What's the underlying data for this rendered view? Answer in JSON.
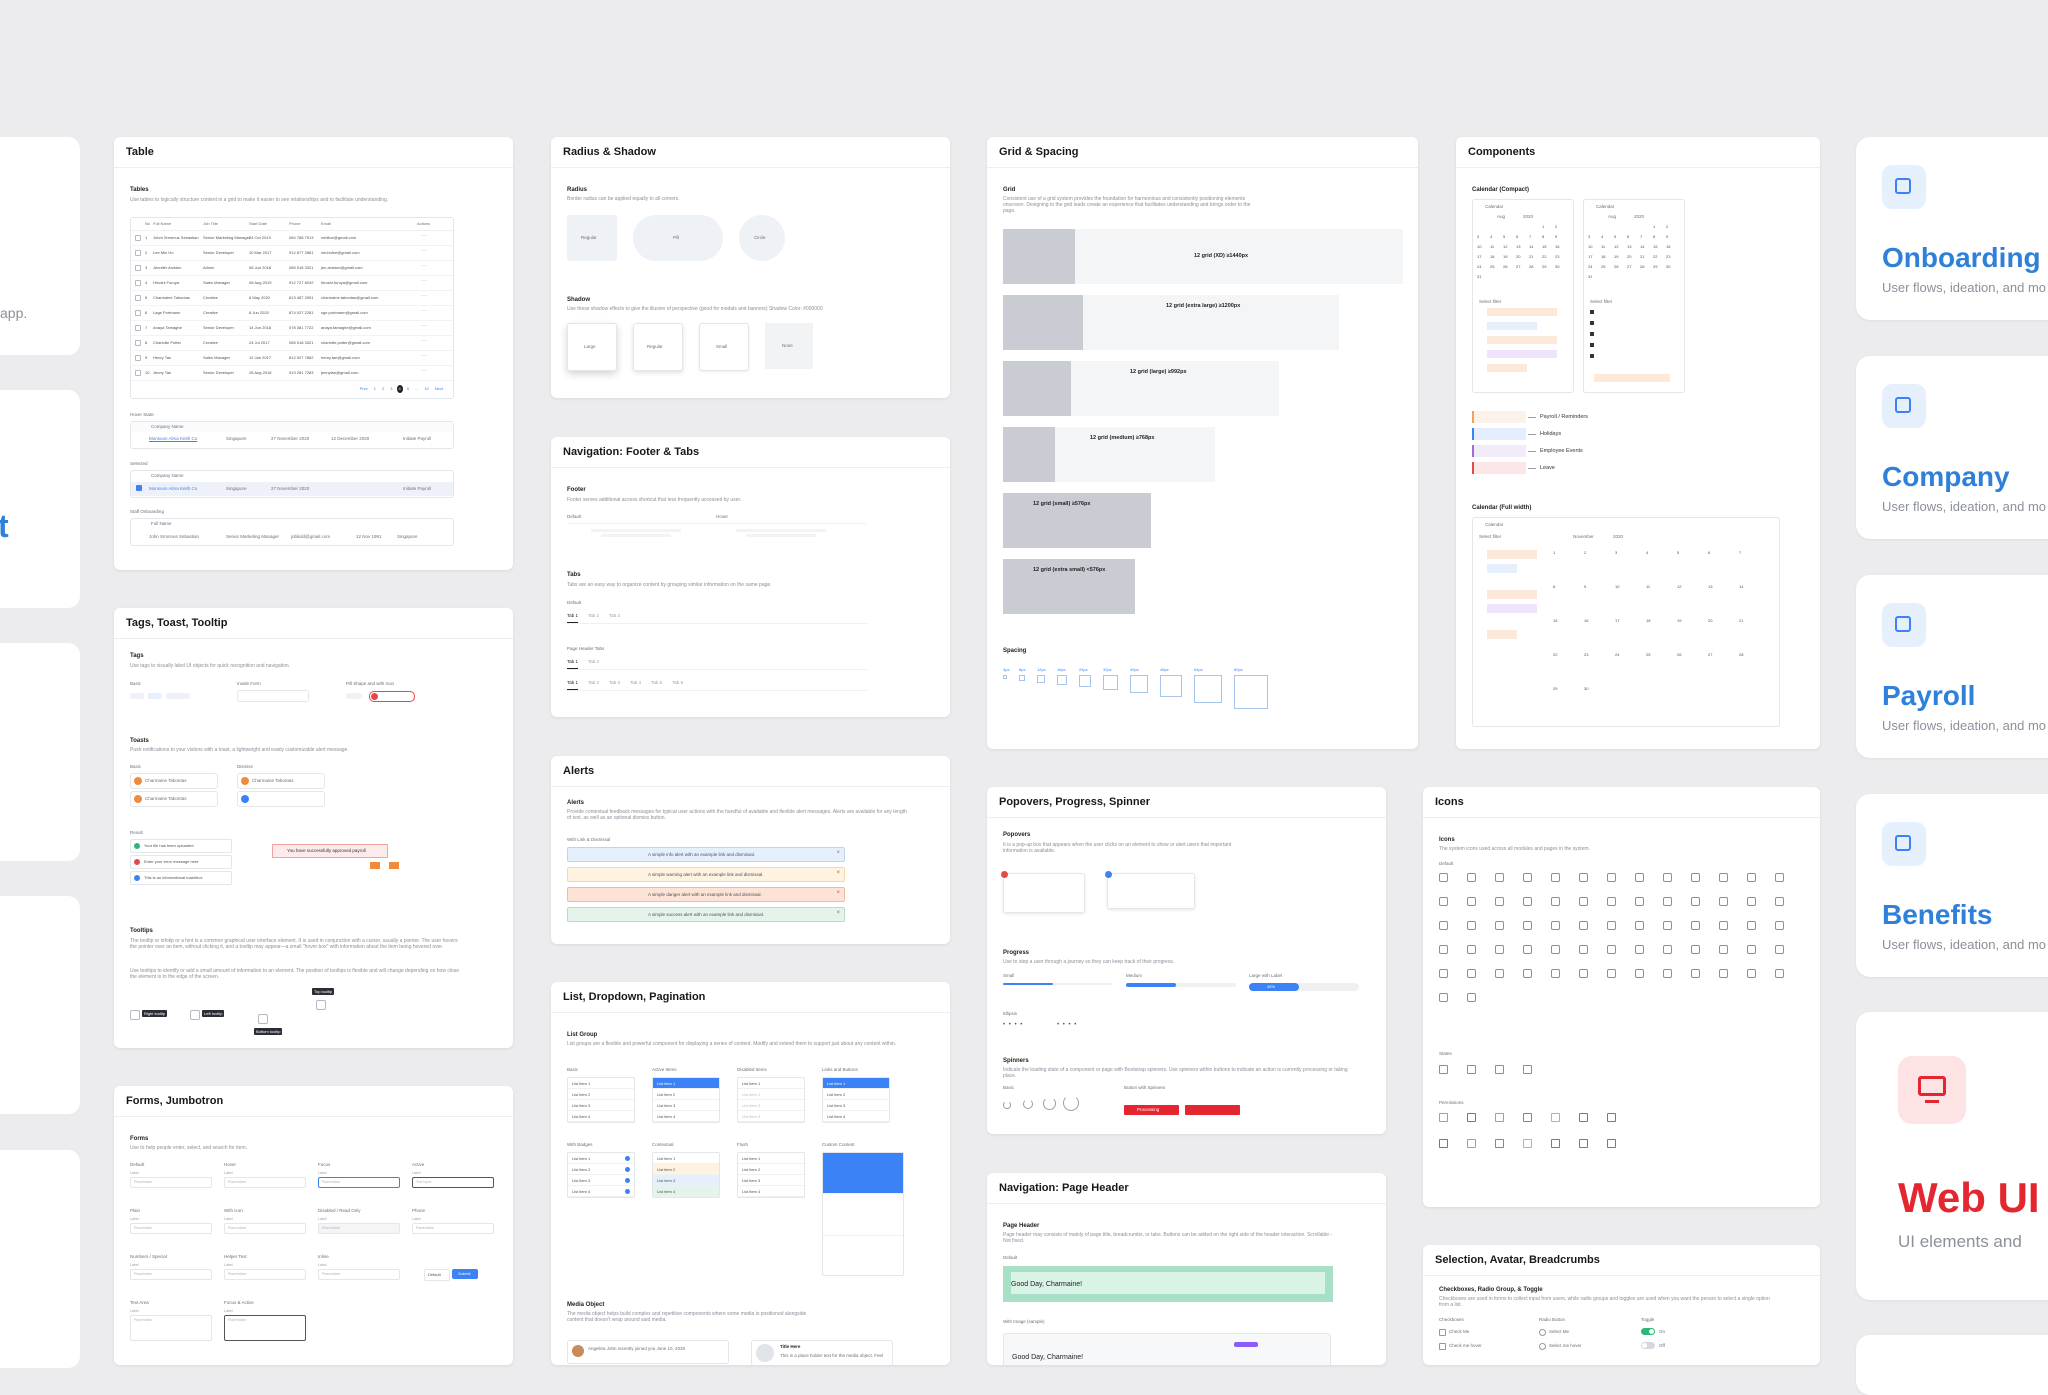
{
  "cards": {
    "table": {
      "title": "Table",
      "section": "Tables",
      "desc": "Use tables to logically structure content in a grid to make it easier to see relationships and to facilitate understanding.",
      "headers": [
        "No",
        "Full Name",
        "Job Title",
        "Start Date",
        "Phone",
        "Email",
        "Actions"
      ],
      "rows": [
        [
          "1",
          "Johm Smmnus Sebastian",
          "Senior Marketing Manager",
          "24 Oct 2019",
          "084 788 7913",
          "rebilion@gmail.com"
        ],
        [
          "2",
          "Lee Min Ho",
          "Senior Developer",
          "10 Mar 2017",
          "912 877 2881",
          "minholee@gmail.com"
        ],
        [
          "3",
          "Jennifer Aniston",
          "Admin",
          "08 Jun 2018",
          "085 018 3321",
          "jen.aniston@gmail.com"
        ],
        [
          "4",
          "Hiroshi Furuya",
          "Sales Manager",
          "08 Aug 2019",
          "912 727 6032",
          "hiroshi.furuya@gmail.com"
        ],
        [
          "5",
          "Charmaine Tabontas",
          "Creative",
          "8 May 2020",
          "813 487 2991",
          "charmaine.tabontas@gmail.com"
        ],
        [
          "6",
          "Lage Portmann",
          "Creative",
          "8 Jun 2020",
          "874 027 2281",
          "sge.portmann@gmail.com"
        ],
        [
          "7",
          "Anaya Tamaghe",
          "Senior Developer",
          "14 Jun 2018",
          "078 381 7722",
          "anaya.tamaghe@gmail.com"
        ],
        [
          "8",
          "Charlotte Potter",
          "Creative",
          "24 Jul 2017",
          "085 018 3321",
          "charlotte.potter@gmail.com"
        ],
        [
          "9",
          "Henry Tan",
          "Sales Manager",
          "12 Jan 2017",
          "812 927 7882",
          "henry.tan@gmail.com"
        ],
        [
          "10",
          "Jenny Tan",
          "Senior Developer",
          "28 Aug 2018",
          "913 281 7283",
          "jennytan@gmail.com"
        ]
      ],
      "pagination": [
        "Prev",
        "1",
        "2",
        "3",
        "4",
        "5",
        "...",
        "10",
        "Next"
      ],
      "hover_state": "Hover State",
      "selected": "Selected",
      "staff_onboarding": "Staff Onboarding",
      "hover_headers": [
        "No",
        "Company Name",
        "Country",
        "Last Payroll",
        "Client in Display"
      ],
      "hover_row": [
        "123",
        "Monsoon Alma Keith Co",
        "Singapore",
        "27 November 2020",
        "12 December 2020",
        "Initiate Payroll"
      ],
      "staff_headers": [
        "No",
        "Full Name",
        "Job Title",
        "Email",
        "Date of Birth",
        "Nationality"
      ],
      "staff_row": [
        "123",
        "John Smmnus Sebastian",
        "Senior Marketing Manager",
        "jobliold@gmail.com",
        "12 Nov 1991",
        "Singapore"
      ]
    },
    "radius": {
      "title": "Radius & Shadow",
      "radius_label": "Radius",
      "radius_desc": "Border radius can be applied equally to all corners.",
      "radius_items": [
        "Regular",
        "Pill",
        "Circle"
      ],
      "shadow_label": "Shadow",
      "shadow_desc": "Use these shadow effects to give the illusion of perspective (good for modals and banners) Shadow Color: #000000",
      "shadow_items": [
        "Large",
        "Regular",
        "Small",
        "None"
      ]
    },
    "footer_tabs": {
      "title": "Navigation: Footer & Tabs",
      "footer_label": "Footer",
      "footer_desc": "Footer serves additional access shortcut that less frequently accessed by user.",
      "default": "Default",
      "hover": "Hover",
      "tabs_label": "Tabs",
      "tabs_desc": "Tabs are an easy way to organize content by grouping similar information on the same page.",
      "tabs": [
        "Tab 1",
        "Tab 2",
        "Tab 3"
      ],
      "page_header_tabs": "Page Header Tabs",
      "header_tabs": [
        "Tab 1",
        "Tab 2"
      ],
      "header_tabs2": [
        "Tab 1",
        "Tab 2",
        "Tab 3",
        "Tab 4",
        "Tab 5",
        "Tab 6"
      ]
    },
    "alerts": {
      "title": "Alerts",
      "label": "Alerts",
      "desc": "Provide contextual feedback messages for typical user actions with the handful of available and flexible alert messages. Alerts are available for any length of text, as well as an optional dismiss button.",
      "sub": "With Link & Dismissal",
      "items": [
        {
          "text": "A simple info alert with an example link and dismissal.",
          "bg": "#e6f0fc",
          "bd": "#b9d4f7"
        },
        {
          "text": "A simple warning alert with an example link and dismissal.",
          "bg": "#fef3e0",
          "bd": "#f6d7a6"
        },
        {
          "text": "A simple danger alert with an example link and dismissal.",
          "bg": "#fde3d6",
          "bd": "#f5b9a0"
        },
        {
          "text": "A simple success alert with an example link and dismissal.",
          "bg": "#e5f4ea",
          "bd": "#b5dfc3"
        }
      ]
    },
    "list": {
      "title": "List, Dropdown, Pagination",
      "label": "List Group",
      "desc": "List groups are a flexible and powerful component for displaying a series of content. Modify and extend them to support just about any content within.",
      "cols": [
        "Basic",
        "Active Items",
        "Disabled Items",
        "Links and Buttons"
      ],
      "cols2": [
        "With Badges",
        "Contextual",
        "Flush",
        "Custom Content"
      ],
      "items": [
        "List item 1",
        "List item 2",
        "List item 3",
        "List item 4"
      ],
      "media_label": "Media Object",
      "media_desc": "The media object helps build complex and repetitive components where some media is positioned alongside content that doesn't wrap around said media.",
      "media_name": "Angelina John recently joined you June 10, 2020",
      "media_title": "Title Here",
      "media_text": "This is a place holder text for the media object. Feel"
    },
    "tags": {
      "title": "Tags, Toast, Tooltip",
      "tags_label": "Tags",
      "tags_desc": "Use tags to visually label UI objects for quick recognition and navigation.",
      "basic": "Basic",
      "inside_form": "Inside Form",
      "pill_shape": "Pill Shape and with Icon",
      "toasts_label": "Toasts",
      "toasts_desc": "Push notifications to your visitors with a toast, a lightweight and easily customizable alert message.",
      "dismiss": "Dismiss",
      "result": "Result",
      "toast_name": "Charmaine Tabontas",
      "result_items": [
        "Your file has been uploaded",
        "Enter your error message here",
        "This is an informational toast/box"
      ],
      "success_text": "You have successfully approved payroll",
      "tooltips_label": "Tooltips",
      "tooltips_desc": "The tooltip or infotip or a hint is a common graphical user interface element. It is used in conjunction with a cursor, usually a pointer. The user hovers the pointer over an item, without clicking it, and a tooltip may appear—a small \"hover box\" with information about the item being hovered over.",
      "tooltips_desc2": "Use tooltips to identify or add a small amount of information to an element. The position of tooltips is flexible and will change depending on how close the element is to the edge of the screen.",
      "tooltip_items": [
        "Right tooltip",
        "Left tooltip",
        "Bottom tooltip",
        "Top tooltip"
      ]
    },
    "forms": {
      "title": "Forms, Jumbotron",
      "label": "Forms",
      "desc": "Use to help people enter, select, and search for item.",
      "row1": [
        "Default",
        "Hover",
        "Focus",
        "Active"
      ],
      "row2": [
        "Plain",
        "With Icon",
        "Disabled / Read Only",
        "Phone"
      ],
      "row3": [
        "Numbers / Special",
        "Helper Text",
        "Inline"
      ],
      "row4": [
        "Text Area",
        "Focus & Active"
      ],
      "field_label": "Label",
      "placeholder": "Placeholder",
      "active_value": "Text Input",
      "submit": "Submit",
      "default_select": "Default"
    },
    "grid": {
      "title": "Grid & Spacing",
      "grid_label": "Grid",
      "grid_desc": "Consistent use of a grid system provides the foundation for harmonious and consistently positioning elements onscreen. Designing to the grid leads create an experience that facilitates understanding and brings order to the page.",
      "rows": [
        "12 grid (XD) ≥1440px",
        "12 grid (extra large) ≥1200px",
        "12 grid (large) ≥992px",
        "12 grid (medium) ≥768px",
        "12 grid (small) ≥576px",
        "12 grid (extra small) <576px"
      ],
      "spacing_label": "Spacing",
      "spacing": [
        "4px",
        "8px",
        "12px",
        "16px",
        "24px",
        "32px",
        "40px",
        "48px",
        "64px",
        "80px"
      ]
    },
    "popovers": {
      "title": "Popovers, Progress, Spinner",
      "popovers_label": "Popovers",
      "popovers_desc": "It is a pop-up box that appears when the user clicks on an element to show or alert users that important information is available.",
      "progress_label": "Progress",
      "progress_desc": "Use to step a user through a journey so they can keep track of their progress.",
      "sizes": [
        "Small",
        "Medium",
        "Large with Label"
      ],
      "progress_value": 0.45,
      "progress_pct": "45%",
      "ellipsis": "Ellipsis",
      "spinners_label": "Spinners",
      "spinners_desc": "Indicate the loading state of a component or page with Bootstrap spinners. Use spinners within buttons to indicate an action is currently processing or taking place.",
      "basic": "Basic",
      "btn_spinners": "Button with Spinners",
      "processing": "Processing"
    },
    "page_header": {
      "title": "Navigation: Page Header",
      "label": "Page Header",
      "desc": "Page header may consists of mainly of page title, breadcrumbs, or tabs. Buttons can be added on the right side of the header interaction. Scrollable - Not fixed.",
      "default": "Default",
      "greeting": "Good Day, Charmaine!",
      "with_image": "With Image (sample)",
      "greeting2": "Good Day, Charmaine!"
    },
    "components": {
      "title": "Components",
      "cal_compact": "Calendar (Compact)",
      "calendar": "Calendar",
      "month": "Aug",
      "year": "2020",
      "select_filter": "Select filter",
      "legend": [
        "Payroll / Reminders",
        "Holidays",
        "Employee Events",
        "Leave"
      ],
      "legend_colors": [
        "#f2a15a",
        "#3b82f6",
        "#a06bd8",
        "#e24a4a"
      ],
      "cal_full": "Calendar (Full width)",
      "month_full": "November",
      "year_full": "2020"
    },
    "icons": {
      "title": "Icons",
      "label": "Icons",
      "desc": "The system icons used across all modules and pages in the system.",
      "default": "Default",
      "states": "States",
      "permissions": "Permissions"
    },
    "selection": {
      "title": "Selection, Avatar, Breadcrumbs",
      "label": "Checkboxes, Radio Group, & Toggle",
      "desc": "Checkboxes are used in forms to collect input from users, while radio groups and toggles are used when you want the person to select a single option from a list.",
      "cols": [
        "Checkboxes",
        "Radio Button",
        "Toggle"
      ],
      "check_items": [
        "Check Me",
        "Check me hover"
      ],
      "radio_items": [
        "Select Me",
        "Select me hover"
      ],
      "toggle_items": [
        "On",
        "Off"
      ]
    }
  },
  "sidebar": [
    {
      "title": "Onboarding",
      "sub": "User flows, ideation, and mo",
      "icon": "clipboard-icon"
    },
    {
      "title": "Company",
      "sub": "User flows, ideation, and mo",
      "icon": "building-icon"
    },
    {
      "title": "Payroll",
      "sub": "User flows, ideation, and mo",
      "icon": "payroll-icon"
    },
    {
      "title": "Benefits",
      "sub": "User flows, ideation, and mo",
      "icon": "gift-icon"
    }
  ],
  "webui": {
    "title": "Web UI",
    "sub": "UI elements and",
    "icon": "monitor-icon",
    "accent": "#e3262f"
  },
  "left_fragments": {
    "app_text": "app.",
    "big_letter": "t"
  },
  "colors": {
    "accent": "#3b82f6",
    "brand": "#2f80d8",
    "background": "#ececee"
  }
}
